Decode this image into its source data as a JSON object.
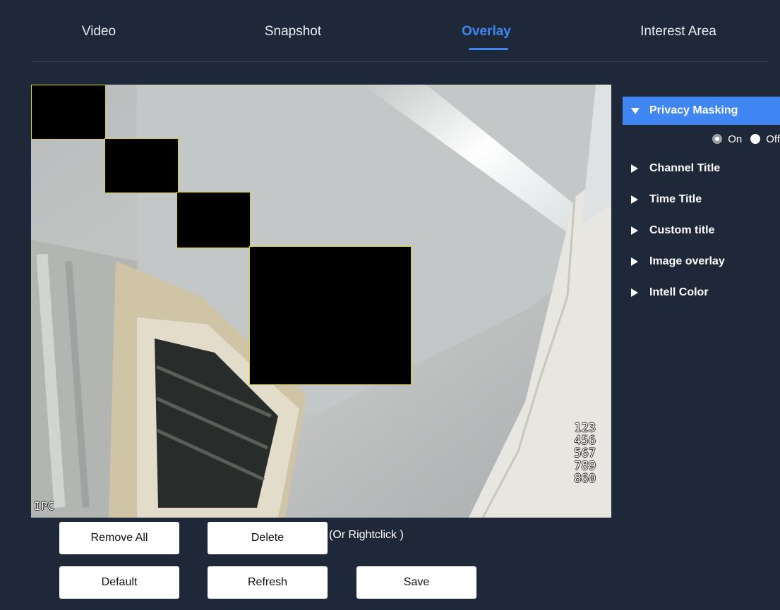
{
  "tabs": [
    {
      "label": "Video",
      "active": false
    },
    {
      "label": "Snapshot",
      "active": false
    },
    {
      "label": "Overlay",
      "active": true
    },
    {
      "label": "Interest Area",
      "active": false
    }
  ],
  "video": {
    "osd_lines": [
      "123",
      "456",
      "567",
      "789",
      "860"
    ],
    "osd_corner": "IPC"
  },
  "side": {
    "privacy_masking": "Privacy Masking",
    "on_label": "On",
    "off_label": "Off",
    "selected": "On",
    "channel_title": "Channel Title",
    "time_title": "Time Title",
    "custom_title": "Custom title",
    "image_overlay": "Image overlay",
    "intell_color": "Intell Color"
  },
  "buttons": {
    "remove_all": "Remove All",
    "delete": "Delete",
    "hint": "(Or Rightclick )",
    "default": "Default",
    "refresh": "Refresh",
    "save": "Save"
  },
  "colors": {
    "background": "#1f2839",
    "accent": "#3f86f2",
    "mask_border": "#d9d31a"
  }
}
